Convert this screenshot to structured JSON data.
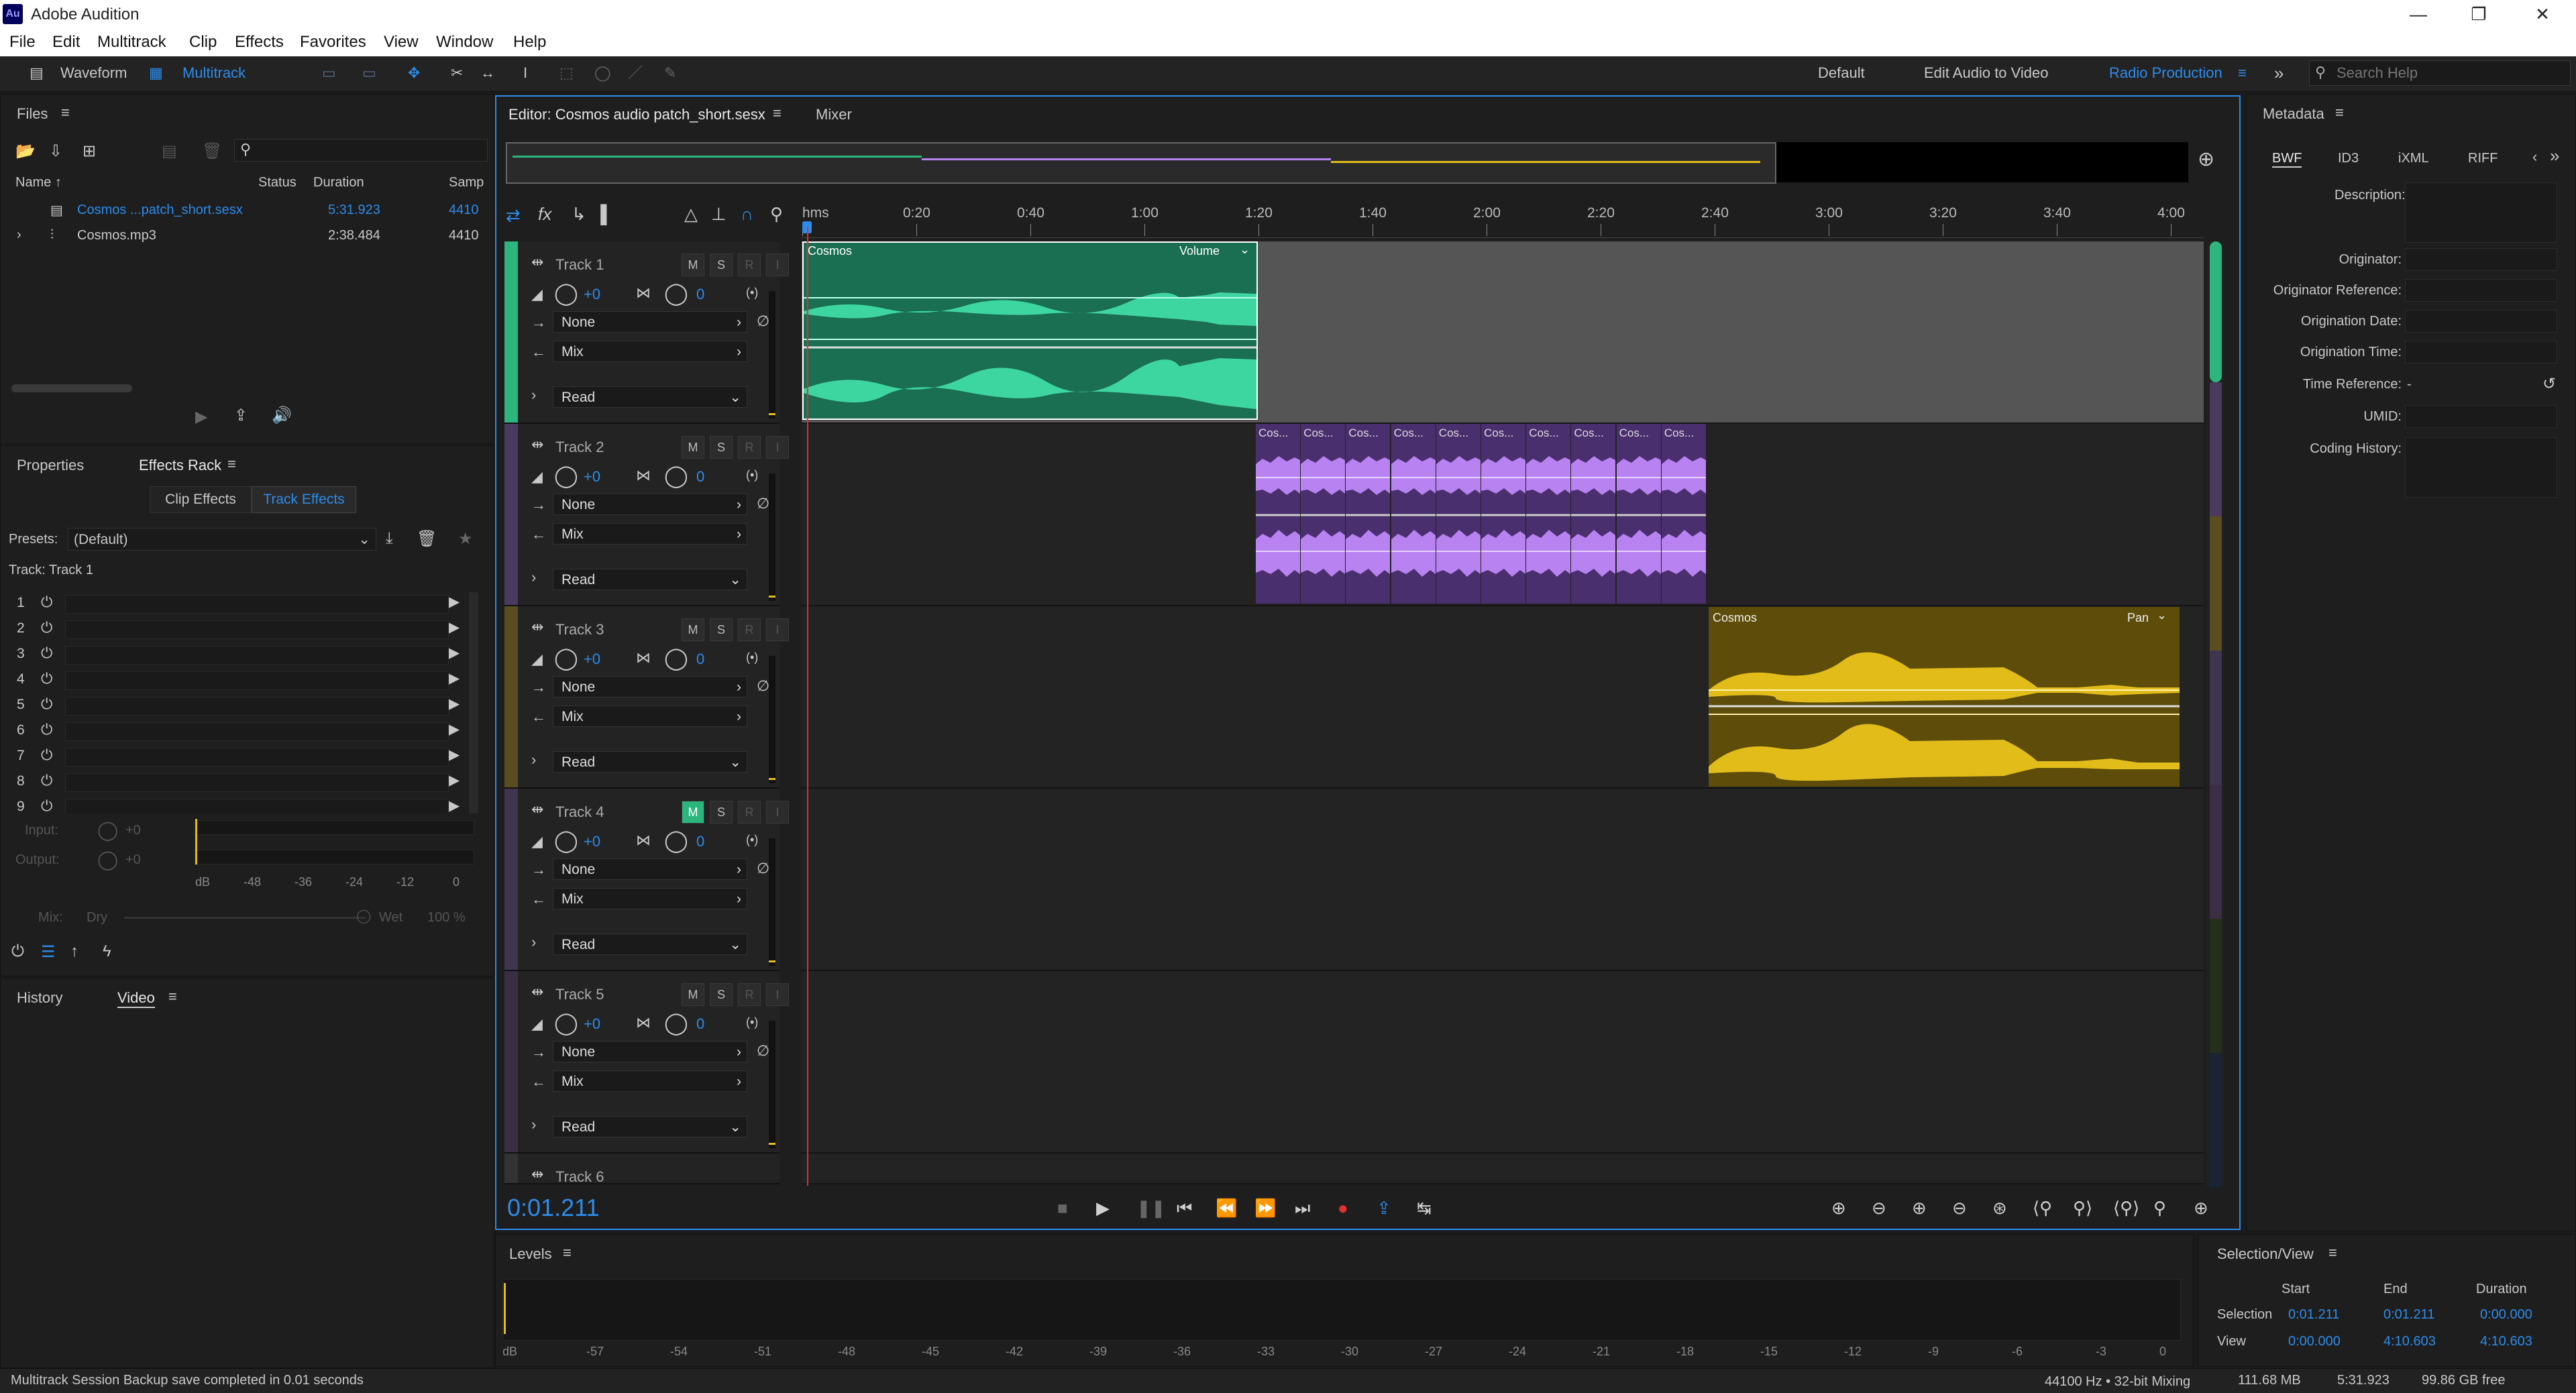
{
  "app": {
    "title": "Adobe Audition",
    "logo": "Au"
  },
  "menu": [
    "File",
    "Edit",
    "Multitrack",
    "Clip",
    "Effects",
    "Favorites",
    "View",
    "Window",
    "Help"
  ],
  "toolbar": {
    "waveform": "Waveform",
    "multitrack": "Multitrack"
  },
  "workspaces": {
    "default": "Default",
    "edit_video": "Edit Audio to Video",
    "radio": "Radio Production",
    "more": "»",
    "search_placeholder": "Search Help"
  },
  "files": {
    "title": "Files",
    "columns": {
      "name": "Name ↑",
      "status": "Status",
      "duration": "Duration",
      "sample": "Samp"
    },
    "rows": [
      {
        "name": "Cosmos ...patch_short.sesx",
        "duration": "5:31.923",
        "sample": "4410"
      },
      {
        "name": "Cosmos.mp3",
        "duration": "2:38.484",
        "sample": "4410"
      }
    ]
  },
  "effects": {
    "tabs": {
      "properties": "Properties",
      "rack": "Effects Rack"
    },
    "subtabs": {
      "clip": "Clip Effects",
      "track": "Track Effects"
    },
    "presets_label": "Presets:",
    "presets_value": "(Default)",
    "track_label": "Track: Track 1",
    "slots": [
      "1",
      "2",
      "3",
      "4",
      "5",
      "6",
      "7",
      "8",
      "9"
    ],
    "input": "Input:",
    "output": "Output:",
    "zero": "+0",
    "db_scale": [
      "dB",
      "-48",
      "-36",
      "-24",
      "-12",
      "0"
    ],
    "mix": "Mix:",
    "dry": "Dry",
    "wet": "Wet",
    "pct": "100 %"
  },
  "history": {
    "history": "History",
    "video": "Video"
  },
  "editor": {
    "tab": "Editor: Cosmos audio patch_short.sesx",
    "mixer": "Mixer",
    "ruler": [
      "hms",
      "0:20",
      "0:40",
      "1:00",
      "1:20",
      "1:40",
      "2:00",
      "2:20",
      "2:40",
      "3:00",
      "3:20",
      "3:40",
      "4:00"
    ],
    "timecode": "0:01.211"
  },
  "tracks": [
    {
      "name": "Track 1",
      "vol": "+0",
      "pan": "0",
      "input": "None",
      "output": "Mix",
      "mode": "Read",
      "color": "#2cb67d"
    },
    {
      "name": "Track 2",
      "vol": "+0",
      "pan": "0",
      "input": "None",
      "output": "Mix",
      "mode": "Read",
      "color": "#4a3a5e"
    },
    {
      "name": "Track 3",
      "vol": "+0",
      "pan": "0",
      "input": "None",
      "output": "Mix",
      "mode": "Read",
      "color": "#5a4e20"
    },
    {
      "name": "Track 4",
      "vol": "+0",
      "pan": "0",
      "input": "None",
      "output": "Mix",
      "mode": "Read",
      "color": "#40354f"
    },
    {
      "name": "Track 5",
      "vol": "+0",
      "pan": "0",
      "input": "None",
      "output": "Mix",
      "mode": "Read",
      "color": "#3b2e44"
    },
    {
      "name": "Track 6"
    }
  ],
  "clips": {
    "clip1_name": "Cosmos",
    "clip1_env": "Volume",
    "clip2_name": "Cos...",
    "clip3_name": "Cosmos",
    "clip3_env": "Pan"
  },
  "metadata": {
    "title": "Metadata",
    "tabs": [
      "BWF",
      "ID3",
      "iXML",
      "RIFF"
    ],
    "fields": {
      "description": "Description:",
      "originator": "Originator:",
      "orig_ref": "Originator Reference:",
      "orig_date": "Origination Date:",
      "orig_time": "Origination Time:",
      "time_ref": "Time Reference:",
      "time_ref_val": "-",
      "umid": "UMID:",
      "coding": "Coding History:"
    }
  },
  "levels": {
    "title": "Levels",
    "scale": [
      "dB",
      "-57",
      "-54",
      "-51",
      "-48",
      "-45",
      "-42",
      "-39",
      "-36",
      "-33",
      "-30",
      "-27",
      "-24",
      "-21",
      "-18",
      "-15",
      "-12",
      "-9",
      "-6",
      "-3",
      "0"
    ]
  },
  "selection": {
    "title": "Selection/View",
    "cols": {
      "start": "Start",
      "end": "End",
      "duration": "Duration"
    },
    "sel": {
      "label": "Selection",
      "start": "0:01.211",
      "end": "0:01.211",
      "duration": "0:00.000"
    },
    "view": {
      "label": "View",
      "start": "0:00.000",
      "end": "4:10.603",
      "duration": "4:10.603"
    }
  },
  "status": {
    "message": "Multitrack Session Backup save completed in 0.01 seconds",
    "format": "44100 Hz • 32-bit Mixing",
    "mem": "111.68 MB",
    "dur": "5:31.923",
    "free": "99.86 GB free"
  },
  "colors": {
    "accent": "#2d8ceb",
    "green": "#3ed6a0",
    "purple": "#b882f0",
    "yellow": "#e2bd1a",
    "playhead": "#e03030"
  }
}
